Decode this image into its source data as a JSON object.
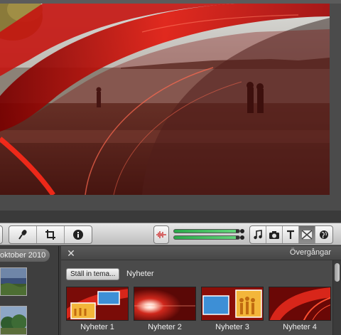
{
  "toolbar": {
    "left_tools": [
      "microphone-icon",
      "crop-icon",
      "info-icon"
    ],
    "right_tools": [
      "music-note-icon",
      "camera-icon",
      "title-icon",
      "transition-icon",
      "globe-icon"
    ],
    "audio_level": 0.95
  },
  "event_browser": {
    "event_title": "oktober 2010"
  },
  "transitions": {
    "panel_title": "Övergångar",
    "theme_button": "Ställ in tema...",
    "theme_name": "Nyheter",
    "items": [
      {
        "label": "Nyheter 1"
      },
      {
        "label": "Nyheter 2"
      },
      {
        "label": "Nyheter 3"
      },
      {
        "label": "Nyheter 4"
      }
    ]
  }
}
